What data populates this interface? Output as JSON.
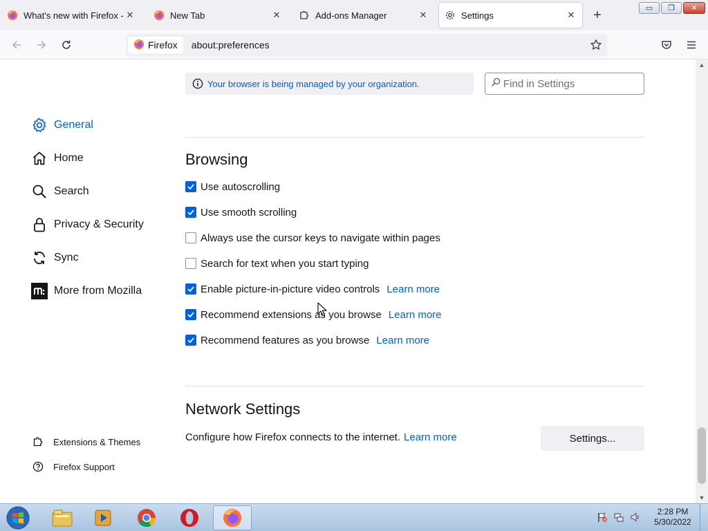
{
  "tabs": [
    {
      "title": "What's new with Firefox - Mo",
      "icon": "firefox-icon"
    },
    {
      "title": "New Tab",
      "icon": "firefox-icon"
    },
    {
      "title": "Add-ons Manager",
      "icon": "puzzle-icon"
    },
    {
      "title": "Settings",
      "icon": "gear-icon",
      "selected": true
    }
  ],
  "new_tab_label": "+",
  "window_controls": {
    "minimize": "▭",
    "restore": "❐",
    "close": "✕"
  },
  "urlbar": {
    "identity_label": "Firefox",
    "url": "about:preferences"
  },
  "sidebar": {
    "items": [
      {
        "label": "General",
        "icon": "gear-icon",
        "active": true
      },
      {
        "label": "Home",
        "icon": "home-icon"
      },
      {
        "label": "Search",
        "icon": "search-icon"
      },
      {
        "label": "Privacy & Security",
        "icon": "lock-icon"
      },
      {
        "label": "Sync",
        "icon": "sync-icon"
      },
      {
        "label": "More from Mozilla",
        "icon": "mozilla-icon"
      }
    ],
    "footer": [
      {
        "label": "Extensions & Themes",
        "icon": "puzzle-icon"
      },
      {
        "label": "Firefox Support",
        "icon": "help-icon"
      }
    ]
  },
  "policy_banner": "Your browser is being managed by your organization.",
  "search": {
    "placeholder": "Find in Settings"
  },
  "browsing": {
    "title": "Browsing",
    "options": [
      {
        "label": "Use autoscrolling",
        "checked": true,
        "learn_more": ""
      },
      {
        "label": "Use smooth scrolling",
        "checked": true,
        "learn_more": ""
      },
      {
        "label": "Always use the cursor keys to navigate within pages",
        "checked": false,
        "learn_more": ""
      },
      {
        "label": "Search for text when you start typing",
        "checked": false,
        "learn_more": ""
      },
      {
        "label": "Enable picture-in-picture video controls",
        "checked": true,
        "learn_more": "Learn more"
      },
      {
        "label": "Recommend extensions as you browse",
        "checked": true,
        "learn_more": "Learn more"
      },
      {
        "label": "Recommend features as you browse",
        "checked": true,
        "learn_more": "Learn more"
      }
    ]
  },
  "network": {
    "title": "Network Settings",
    "description": "Configure how Firefox connects to the internet.",
    "learn_more": "Learn more",
    "button": "Settings..."
  },
  "taskbar": {
    "apps": [
      "windows-explorer-icon",
      "media-player-icon",
      "chrome-icon",
      "opera-icon",
      "firefox-icon"
    ],
    "clock_time": "2:28 PM",
    "clock_date": "5/30/2022"
  },
  "colors": {
    "accent": "#0061e0",
    "tabstrip_bg": "#f0f0f4",
    "text": "#15141a"
  }
}
